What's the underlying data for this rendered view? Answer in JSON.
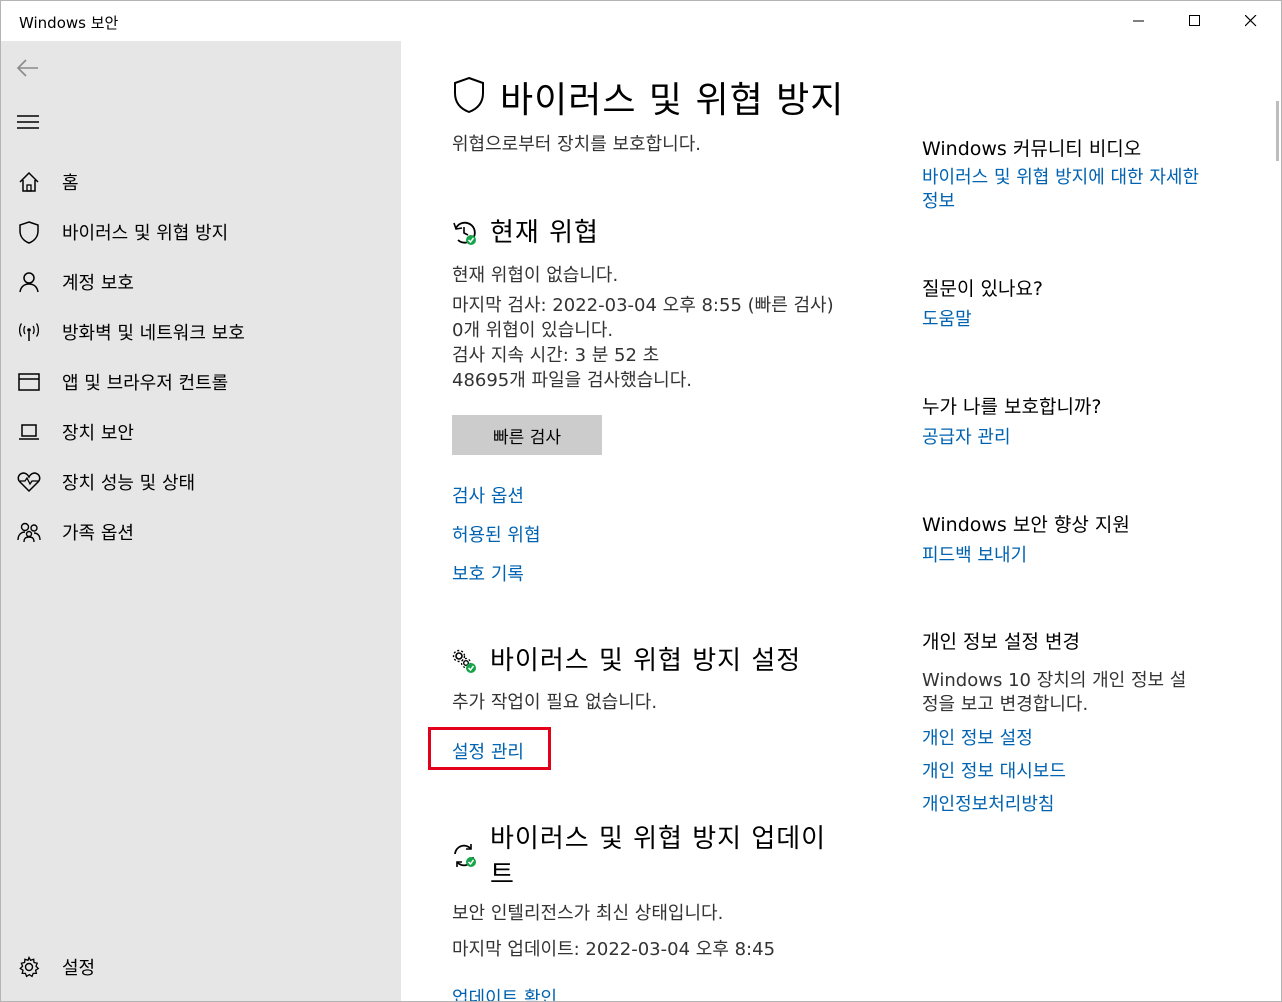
{
  "window": {
    "title": "Windows 보안"
  },
  "sidebar": {
    "items": [
      {
        "label": "홈",
        "icon": "home-icon"
      },
      {
        "label": "바이러스 및 위협 방지",
        "icon": "shield-icon"
      },
      {
        "label": "계정 보호",
        "icon": "person-icon"
      },
      {
        "label": "방화벽 및 네트워크 보호",
        "icon": "wireless-icon"
      },
      {
        "label": "앱 및 브라우저 컨트롤",
        "icon": "browser-window-icon"
      },
      {
        "label": "장치 보안",
        "icon": "laptop-icon"
      },
      {
        "label": "장치 성능 및 상태",
        "icon": "heart-pulse-icon"
      },
      {
        "label": "가족 옵션",
        "icon": "family-icon"
      }
    ],
    "settings_label": "설정"
  },
  "main": {
    "title": "바이러스 및 위협 방지",
    "subtitle": "위협으로부터 장치를 보호합니다.",
    "current_threats": {
      "heading": "현재 위협",
      "lines": [
        "현재 위협이 없습니다.",
        "마지막 검사: 2022-03-04 오후 8:55 (빠른 검사)",
        "0개 위협이 있습니다.",
        "검사 지속 시간: 3 분 52 초",
        "48695개 파일을 검사했습니다."
      ],
      "quick_scan_button": "빠른 검사",
      "links": [
        "검사 옵션",
        "허용된 위협",
        "보호 기록"
      ]
    },
    "protection_settings": {
      "heading": "바이러스 및 위협 방지 설정",
      "status": "추가 작업이 필요 없습니다.",
      "manage_link": "설정 관리"
    },
    "updates": {
      "heading_line1": "바이러스 및 위협 방지 업데이",
      "heading_line2": "트",
      "status": "보안 인텔리전스가 최신 상태입니다.",
      "last_update": "마지막 업데이트: 2022-03-04 오후 8:45",
      "check_link": "업데이트 확인"
    }
  },
  "right": {
    "community": {
      "heading": "Windows 커뮤니티 비디오",
      "link_line1": "바이러스 및 위협 방지에 대한 자세한",
      "link_line2": "정보"
    },
    "question": {
      "heading": "질문이 있나요?",
      "link": "도움말"
    },
    "protector": {
      "heading": "누가 나를 보호합니까?",
      "link": "공급자 관리"
    },
    "improve": {
      "heading": "Windows 보안 향상 지원",
      "link": "피드백 보내기"
    },
    "privacy": {
      "heading": "개인 정보 설정 변경",
      "text_line1": "Windows 10 장치의 개인 정보 설",
      "text_line2": "정을 보고 변경합니다.",
      "links": [
        "개인 정보 설정",
        "개인 정보 대시보드",
        "개인정보처리방침"
      ]
    }
  },
  "colors": {
    "link": "#0063b1",
    "sidebar_bg": "#e6e6e6",
    "highlight": "#e3001b",
    "status_green": "#16a34a"
  }
}
